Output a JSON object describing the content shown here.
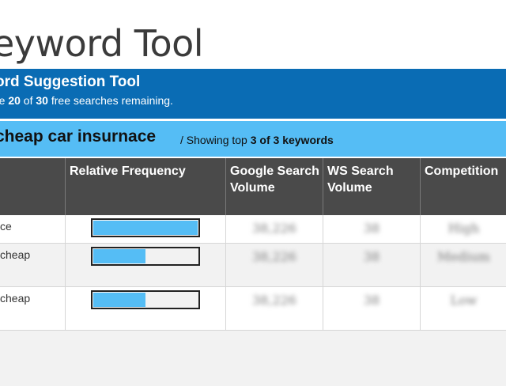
{
  "page": {
    "title": "eyword Tool"
  },
  "tool": {
    "title": "ord Suggestion Tool",
    "sub_prefix": "re ",
    "remaining": "20",
    "sub_mid": " of ",
    "total": "30",
    "sub_suffix": " free searches remaining."
  },
  "search": {
    "query": "cheap car insurnace",
    "showing_prefix": "/ Showing top ",
    "shown": "3 of 3 keywords"
  },
  "table": {
    "headers": {
      "keyword": "",
      "relative_frequency": "Relative Frequency",
      "google_volume": "Google Search Volume",
      "ws_volume": "WS Search Volume",
      "competition": "Competition"
    },
    "rows": [
      {
        "keyword": "ce",
        "frequency": 1.0,
        "google": "38,226",
        "ws": "38",
        "competition": "High"
      },
      {
        "keyword": "cheap",
        "frequency": 0.5,
        "google": "38,226",
        "ws": "38",
        "competition": "Medium"
      },
      {
        "keyword": "cheap",
        "frequency": 0.5,
        "google": "38,226",
        "ws": "38",
        "competition": "Low"
      }
    ]
  },
  "colors": {
    "tool_bar": "#0a6cb4",
    "search_bar": "#55bdf5",
    "header_bg": "#4a4a4a",
    "bar_fill": "#55bdf5"
  }
}
